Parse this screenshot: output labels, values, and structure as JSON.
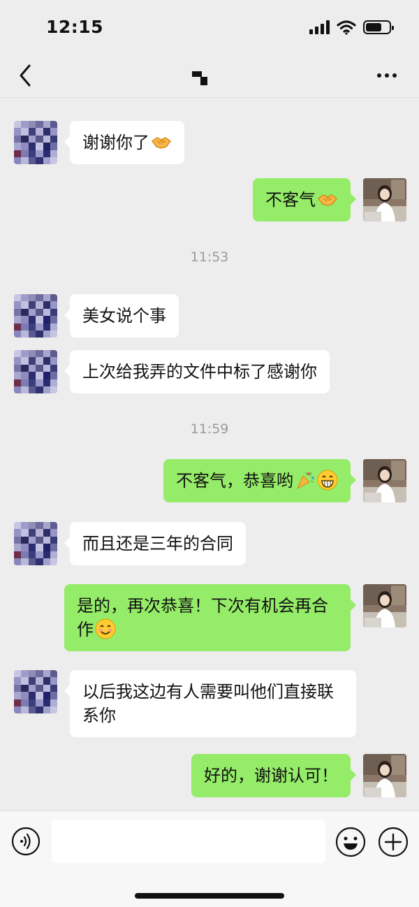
{
  "status_bar": {
    "time": "12:15",
    "battery_level": 0.7
  },
  "header": {
    "back_icon": "chevron-left-icon",
    "title_icon": "corner-mark-icon",
    "more_icon": "ellipsis-icon"
  },
  "messages": [
    {
      "side": "left",
      "text": "谢谢你了",
      "emoji": "handshake"
    },
    {
      "side": "right",
      "text": "不客气",
      "emoji": "handshake"
    },
    {
      "type": "time",
      "text": "11:53"
    },
    {
      "side": "left",
      "text": "美女说个事"
    },
    {
      "side": "left",
      "text": "上次给我弄的文件中标了感谢你"
    },
    {
      "type": "time",
      "text": "11:59"
    },
    {
      "side": "right",
      "text": "不客气，恭喜哟",
      "emoji": "party-popper, grinning-face"
    },
    {
      "side": "left",
      "text": "而且还是三年的合同"
    },
    {
      "side": "right",
      "text": "是的，再次恭喜！下次有机会再合作",
      "emoji": "smiling-face"
    },
    {
      "side": "left",
      "text": "以后我这边有人需要叫他们直接联系你"
    },
    {
      "side": "right",
      "text": "好的，谢谢认可！"
    }
  ],
  "input_bar": {
    "voice_icon": "voice-icon",
    "emoji_icon": "smiley-icon",
    "plus_icon": "plus-icon",
    "value": ""
  },
  "colors": {
    "background": "#ededed",
    "outgoing_bubble": "#95ec69",
    "incoming_bubble": "#ffffff",
    "timestamp_text": "#9b9b9b"
  }
}
